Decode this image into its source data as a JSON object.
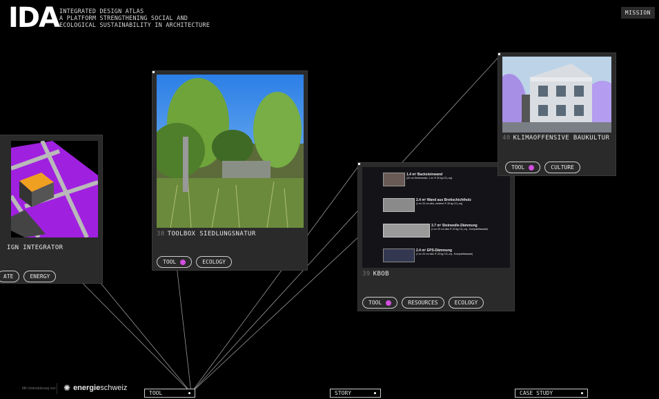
{
  "header": {
    "logo": "IDA",
    "tagline_lines": [
      "INTEGRATED DESIGN ATLAS",
      "A PLATFORM STRENGTHENING SOCIAL AND",
      "ECOLOGICAL SUSTAINABILITY IN ARCHITECTURE"
    ],
    "mission_label": "MISSION"
  },
  "cards": [
    {
      "num": "",
      "title": "IGN INTEGRATOR",
      "tags": [
        "ATE",
        "ENERGY"
      ]
    },
    {
      "num": "38",
      "title": "TOOLBOX SIEDLUNGSNATUR",
      "tags": [
        "TOOL",
        "ECOLOGY"
      ]
    },
    {
      "num": "39",
      "title": "KBOB",
      "tags": [
        "TOOL",
        "RESOURCES",
        "ECOLOGY"
      ],
      "kbob_items": [
        {
          "title": "1.4 m² Backsteinwand",
          "sub": "(20 cm Seinemodul; 1 m² ≙ 33 kg CO₂-eq)"
        },
        {
          "title": "2.4 m² Wand aus Brettschichtholz",
          "sub": "(1 m² 20 cm dick, verleimt ≙ 30 kg CO₂-eq)"
        },
        {
          "title": "3.7 m² Steinwolle-Dämmung",
          "sub": "(1 m² 20 cm dick ≙ 22 kg CO₂-eq - Kompaktfassade)"
        },
        {
          "title": "2.4 m² EPS-Dämmung",
          "sub": "(1 m² 20 cm dick ≙ 33 kg CO₂-eq - Kompaktfassade)"
        }
      ]
    },
    {
      "num": "40",
      "title": "KLIMAOFFENSIVE BAUKULTUR",
      "tags": [
        "TOOL",
        "CULTURE"
      ]
    }
  ],
  "footer": {
    "sponsor_small": "Mit Unterstützung von",
    "sponsor_brand_bold": "energie",
    "sponsor_brand_light": "schweiz",
    "filters": [
      "TOOL",
      "STORY",
      "CASE STUDY"
    ]
  },
  "colors": {
    "accent_dot": "#d24fe0",
    "card_bg": "#2a2a2a",
    "ground_purple": "#a020e0",
    "building_orange": "#f0a020"
  }
}
